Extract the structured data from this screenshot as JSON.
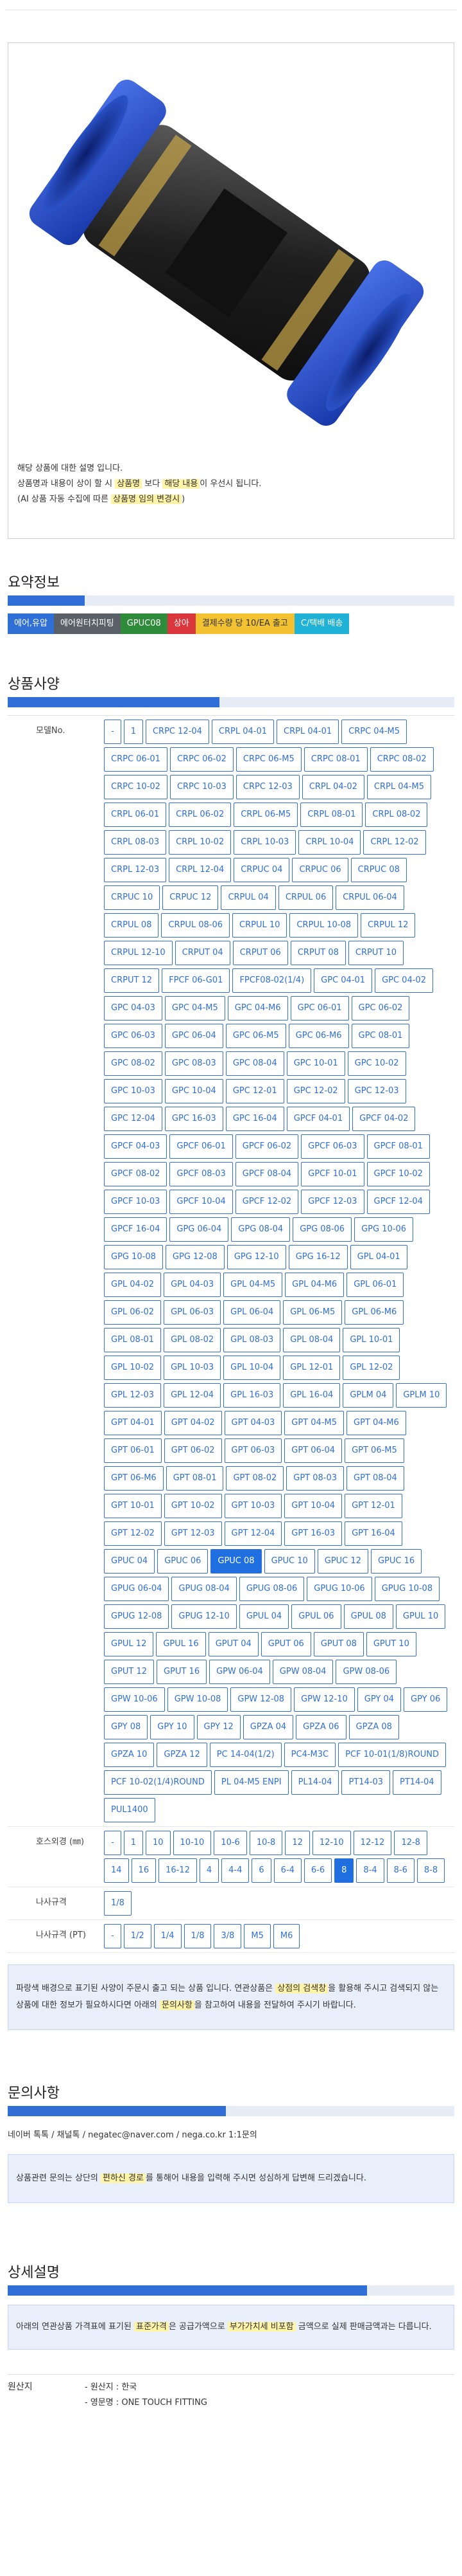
{
  "product": {
    "desc_line1": "해당 상품에 대한 설명 입니다.",
    "desc_line2_a": "상품명과 내용이 상이 할 시 ",
    "desc_line2_hl1": "상품명",
    "desc_line2_b": " 보다 ",
    "desc_line2_hl2": "해당 내용",
    "desc_line2_c": "이 우선시 됩니다.",
    "desc_line3_a": "(AI 상품 자동 수집에 따른 ",
    "desc_line3_hl": "상품명 임의 변경시",
    "desc_line3_b": ")"
  },
  "summary": {
    "title": "요약정보",
    "chips": [
      {
        "label": "에어,유압",
        "color": "#2f6fd6"
      },
      {
        "label": "에어원터치피팅",
        "color": "#5a6068"
      },
      {
        "label": "GPUC08",
        "color": "#2e8b3a"
      },
      {
        "label": "상아",
        "color": "#d9363e"
      },
      {
        "label": "결제수량 당 10/EA 출고",
        "color": "#f2c230"
      },
      {
        "label": "C/택배 배송",
        "color": "#1fb2d6"
      }
    ]
  },
  "spec": {
    "title": "상품사양",
    "rows": [
      {
        "label": "모델No.",
        "selected": "GPUC 08",
        "options": [
          "-",
          "1",
          "CRPC 12-04",
          "CRPL 04-01",
          "CRPL 04-01",
          "CRPC 04-M5",
          "CRPC 06-01",
          "CRPC 06-02",
          "CRPC 06-M5",
          "CRPC 08-01",
          "CRPC 08-02",
          "CRPC 10-02",
          "CRPC 10-03",
          "CRPC 12-03",
          "CRPL 04-02",
          "CRPL 04-M5",
          "CRPL 06-01",
          "CRPL 06-02",
          "CRPL 06-M5",
          "CRPL 08-01",
          "CRPL 08-02",
          "CRPL 08-03",
          "CRPL 10-02",
          "CRPL 10-03",
          "CRPL 10-04",
          "CRPL 12-02",
          "CRPL 12-03",
          "CRPL 12-04",
          "CRPUC 04",
          "CRPUC 06",
          "CRPUC 08",
          "CRPUC 10",
          "CRPUC 12",
          "CRPUL 04",
          "CRPUL 06",
          "CRPUL 06-04",
          "CRPUL 08",
          "CRPUL 08-06",
          "CRPUL 10",
          "CRPUL 10-08",
          "CRPUL 12",
          "CRPUL 12-10",
          "CRPUT 04",
          "CRPUT 06",
          "CRPUT 08",
          "CRPUT 10",
          "CRPUT 12",
          "FPCF 06-G01",
          "FPCF08-02(1/4)",
          "GPC 04-01",
          "GPC 04-02",
          "GPC 04-03",
          "GPC 04-M5",
          "GPC 04-M6",
          "GPC 06-01",
          "GPC 06-02",
          "GPC 06-03",
          "GPC 06-04",
          "GPC 06-M5",
          "GPC 06-M6",
          "GPC 08-01",
          "GPC 08-02",
          "GPC 08-03",
          "GPC 08-04",
          "GPC 10-01",
          "GPC 10-02",
          "GPC 10-03",
          "GPC 10-04",
          "GPC 12-01",
          "GPC 12-02",
          "GPC 12-03",
          "GPC 12-04",
          "GPC 16-03",
          "GPC 16-04",
          "GPCF 04-01",
          "GPCF 04-02",
          "GPCF 04-03",
          "GPCF 06-01",
          "GPCF 06-02",
          "GPCF 06-03",
          "GPCF 08-01",
          "GPCF 08-02",
          "GPCF 08-03",
          "GPCF 08-04",
          "GPCF 10-01",
          "GPCF 10-02",
          "GPCF 10-03",
          "GPCF 10-04",
          "GPCF 12-02",
          "GPCF 12-03",
          "GPCF 12-04",
          "GPCF 16-04",
          "GPG 06-04",
          "GPG 08-04",
          "GPG 08-06",
          "GPG 10-06",
          "GPG 10-08",
          "GPG 12-08",
          "GPG 12-10",
          "GPG 16-12",
          "GPL 04-01",
          "GPL 04-02",
          "GPL 04-03",
          "GPL 04-M5",
          "GPL 04-M6",
          "GPL 06-01",
          "GPL 06-02",
          "GPL 06-03",
          "GPL 06-04",
          "GPL 06-M5",
          "GPL 06-M6",
          "GPL 08-01",
          "GPL 08-02",
          "GPL 08-03",
          "GPL 08-04",
          "GPL 10-01",
          "GPL 10-02",
          "GPL 10-03",
          "GPL 10-04",
          "GPL 12-01",
          "GPL 12-02",
          "GPL 12-03",
          "GPL 12-04",
          "GPL 16-03",
          "GPL 16-04",
          "GPLM 04",
          "GPLM 10",
          "GPT 04-01",
          "GPT 04-02",
          "GPT 04-03",
          "GPT 04-M5",
          "GPT 04-M6",
          "GPT 06-01",
          "GPT 06-02",
          "GPT 06-03",
          "GPT 06-04",
          "GPT 06-M5",
          "GPT 06-M6",
          "GPT 08-01",
          "GPT 08-02",
          "GPT 08-03",
          "GPT 08-04",
          "GPT 10-01",
          "GPT 10-02",
          "GPT 10-03",
          "GPT 10-04",
          "GPT 12-01",
          "GPT 12-02",
          "GPT 12-03",
          "GPT 12-04",
          "GPT 16-03",
          "GPT 16-04",
          "GPUC 04",
          "GPUC 06",
          "GPUC 08",
          "GPUC 10",
          "GPUC 12",
          "GPUC 16",
          "GPUG 06-04",
          "GPUG 08-04",
          "GPUG 08-06",
          "GPUG 10-06",
          "GPUG 10-08",
          "GPUG 12-08",
          "GPUG 12-10",
          "GPUL 04",
          "GPUL 06",
          "GPUL 08",
          "GPUL 10",
          "GPUL 12",
          "GPUL 16",
          "GPUT 04",
          "GPUT 06",
          "GPUT 08",
          "GPUT 10",
          "GPUT 12",
          "GPUT 16",
          "GPW 06-04",
          "GPW 08-04",
          "GPW 08-06",
          "GPW 10-06",
          "GPW 10-08",
          "GPW 12-08",
          "GPW 12-10",
          "GPY 04",
          "GPY 06",
          "GPY 08",
          "GPY 10",
          "GPY 12",
          "GPZA 04",
          "GPZA 06",
          "GPZA 08",
          "GPZA 10",
          "GPZA 12",
          "PC 14-04(1/2)",
          "PC4-M3C",
          "PCF 10-01(1/8)ROUND",
          "PCF 10-02(1/4)ROUND",
          "PL 04-M5 ENPI",
          "PL14-04",
          "PT14-03",
          "PT14-04",
          "PUL1400"
        ]
      },
      {
        "label": "호스외경 (㎜)",
        "selected": "8",
        "options": [
          "-",
          "1",
          "10",
          "10-10",
          "10-6",
          "10-8",
          "12",
          "12-10",
          "12-12",
          "12-8",
          "14",
          "16",
          "16-12",
          "4",
          "4-4",
          "6",
          "6-4",
          "6-6",
          "8",
          "8-4",
          "8-6",
          "8-8"
        ]
      },
      {
        "label": "나사규격",
        "selected": "",
        "options": [
          "1/8"
        ]
      },
      {
        "label": "나사규격 (PT)",
        "selected": "",
        "options": [
          "-",
          "1/2",
          "1/4",
          "1/8",
          "3/8",
          "M5",
          "M6"
        ]
      }
    ],
    "notice_a": "파랑색 배경으로 표기된 사양이 주문시 출고 되는 상품 입니다. 연관상품은 ",
    "notice_hl1": "상점의 검색창",
    "notice_b": "을 활용해 주시고 검색되지 않는 상품에 대한 정보가 필요하시다면 아래의 ",
    "notice_hl2": "문의사항",
    "notice_c": "을 참고하여 내용을 전달하여 주시기 바랍니다."
  },
  "inquiry": {
    "title": "문의사항",
    "line": "네이버 톡톡 / 채널톡 / negatec@naver.com / nega.co.kr 1:1문의",
    "box_a": "상품관련 문의는 상단의 ",
    "box_hl": "편하신 경로",
    "box_b": "를 통해어 내용을 입력해 주시면 성심하게 답변해 드리겠습니다."
  },
  "detail": {
    "title": "상세설명",
    "box_a": "아래의 연관상품 가격표에 표기된 ",
    "box_hl1": "표준가격",
    "box_b": "은 공급가액으로 ",
    "box_hl2": "부가가치세 비포함",
    "box_c": " 금액으로 실제 판매금액과는 다릅니다.",
    "meta_label": "원산지",
    "meta_line1": "- 원산지 : 한국",
    "meta_line2": "- 영문명 : ONE TOUCH FITTING"
  }
}
